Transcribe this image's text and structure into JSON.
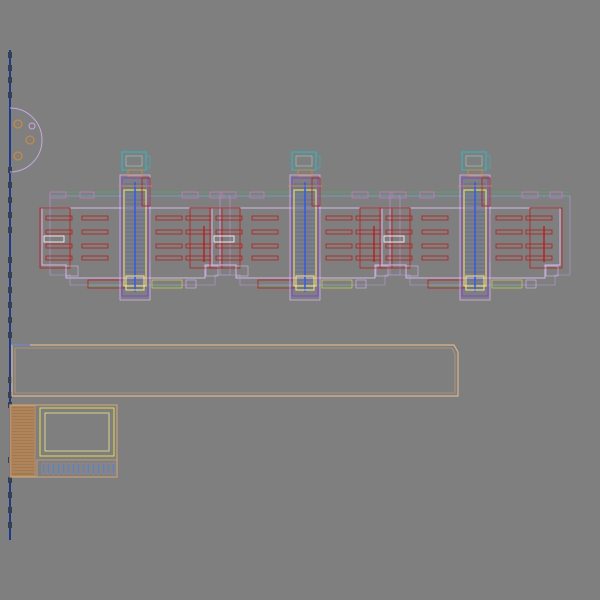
{
  "view": {
    "background": "#7f7f7f"
  },
  "drawing": {
    "block_count": 3,
    "colors": {
      "axis_line": "#1e3a8a",
      "axis_node": "#334155",
      "outline": "#d4b7e8",
      "room_red": "#b91c1c",
      "core_blue": "#3b5bdb",
      "core_yellow": "#e7d94b",
      "core_purple": "#7c3aed",
      "cyan": "#2fb8c4",
      "green": "#3fbf5a",
      "orange": "#d98b3a",
      "tan": "#c9a27a",
      "mint": "#8fd3c9",
      "pink": "#c97ab8"
    }
  }
}
